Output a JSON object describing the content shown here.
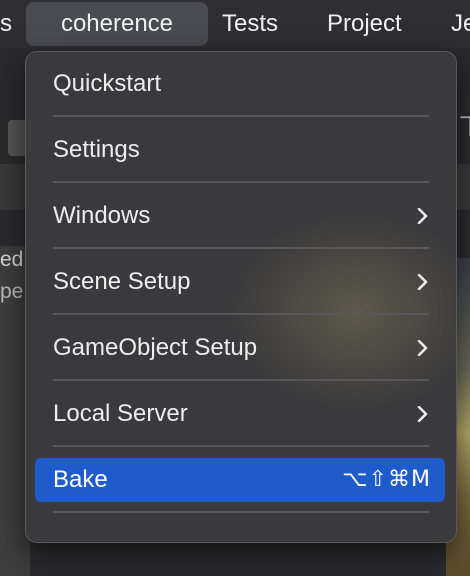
{
  "menubar": {
    "items": [
      {
        "label": "s"
      },
      {
        "label": "coherence"
      },
      {
        "label": "Tests"
      },
      {
        "label": "Project"
      },
      {
        "label": "Je"
      }
    ]
  },
  "background": {
    "text_1": "ed",
    "text_2": "pe"
  },
  "menu": {
    "items": [
      {
        "label": "Quickstart",
        "submenu": false
      },
      {
        "label": "Settings",
        "submenu": false
      },
      {
        "label": "Windows",
        "submenu": true
      },
      {
        "label": "Scene Setup",
        "submenu": true
      },
      {
        "label": "GameObject Setup",
        "submenu": true
      },
      {
        "label": "Local Server",
        "submenu": true
      },
      {
        "label": "Bake",
        "submenu": false,
        "selected": true,
        "shortcut": "⌥⇧⌘M"
      }
    ]
  },
  "colors": {
    "selection": "#1f5ccb",
    "menu_bg": "#3a3a3c",
    "menubar_bg": "#2f2e33"
  }
}
